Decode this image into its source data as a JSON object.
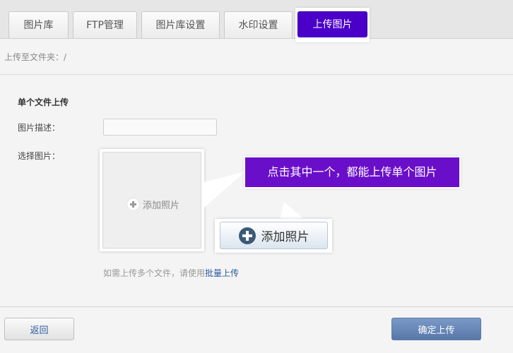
{
  "tabs": [
    {
      "label": "图片库"
    },
    {
      "label": "FTP管理"
    },
    {
      "label": "图片库设置"
    },
    {
      "label": "水印设置"
    },
    {
      "label": "上传图片",
      "active": true
    }
  ],
  "breadcrumb": "上传至文件夹：/",
  "section": {
    "title": "单个文件上传",
    "desc_label": "图片描述：",
    "desc_value": "",
    "desc_placeholder": "",
    "pick_label": "选择图片："
  },
  "upload_box": {
    "icon": "plus-circle-icon",
    "label": "添加照片"
  },
  "add_button": {
    "icon": "plus-circle-icon",
    "label": "添加照片"
  },
  "callout": {
    "text": "点击其中一个，都能上传单个图片",
    "color": "#6a0fc9"
  },
  "hint": {
    "prefix": "如需上传多个文件，请使用",
    "link": "批量上传"
  },
  "footer": {
    "back_label": "返回",
    "confirm_label": "确定上传"
  },
  "colors": {
    "active_tab": "#4a00c9",
    "link": "#2a5aa0",
    "confirm_button": "#5877a9"
  }
}
